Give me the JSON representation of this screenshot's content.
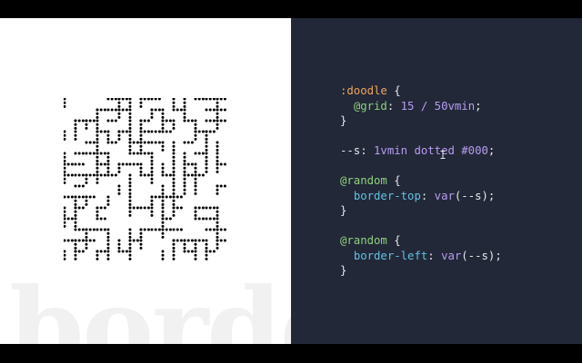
{
  "slide": {
    "watermark": "border",
    "code": {
      "line1": {
        "selector": ":doodle",
        "brace": " {"
      },
      "line2": {
        "at": "@grid",
        "colon": ": ",
        "value": "15 / 50vmin",
        "semi": ";"
      },
      "line3": {
        "brace": "}"
      },
      "line4": {
        "var": "--s",
        "colon": ": ",
        "value": "1vmin dotted #000",
        "semi": ";"
      },
      "line5": {
        "at": "@random",
        "brace": " {"
      },
      "line6": {
        "prop": "border-top",
        "colon": ": ",
        "fn": "var",
        "arg": "(--s)",
        "semi": ";"
      },
      "line7": {
        "brace": "}"
      },
      "line8": {
        "at": "@random",
        "brace": " {"
      },
      "line9": {
        "prop": "border-left",
        "colon": ": ",
        "fn": "var",
        "arg": "(--s)",
        "semi": ";"
      },
      "line10": {
        "brace": "}"
      }
    }
  },
  "colors": {
    "code_background": "#222837",
    "preview_background": "#ffffff",
    "selector": "#f0a45d",
    "at_rule": "#8fd07f",
    "value": "#b79cf2",
    "property": "#61c0e4"
  },
  "grid": {
    "cols": 15,
    "rows": 15,
    "dot_color": "#000000"
  }
}
